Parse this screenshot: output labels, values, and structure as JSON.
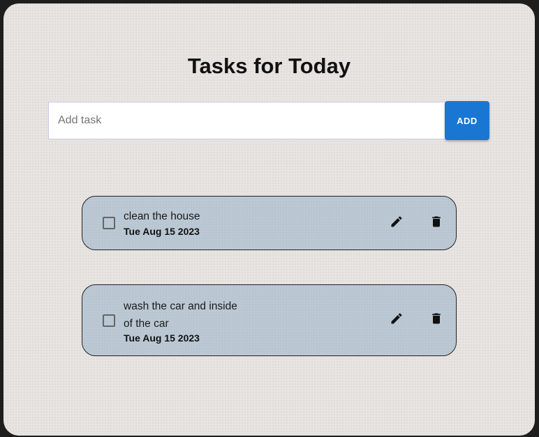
{
  "header": {
    "title": "Tasks for Today"
  },
  "add_form": {
    "placeholder": "Add task",
    "value": "",
    "button_label": "ADD"
  },
  "tasks": [
    {
      "text": "clean the house",
      "date": "Tue Aug 15 2023",
      "completed": false
    },
    {
      "text": "wash the car and inside of the car",
      "date": "Tue Aug 15 2023",
      "completed": false
    }
  ],
  "icons": {
    "edit": "pencil-icon",
    "delete": "trash-icon"
  },
  "colors": {
    "accent": "#1976d2",
    "card_background": "#b8c6d2",
    "page_background": "#e8e4e2"
  }
}
